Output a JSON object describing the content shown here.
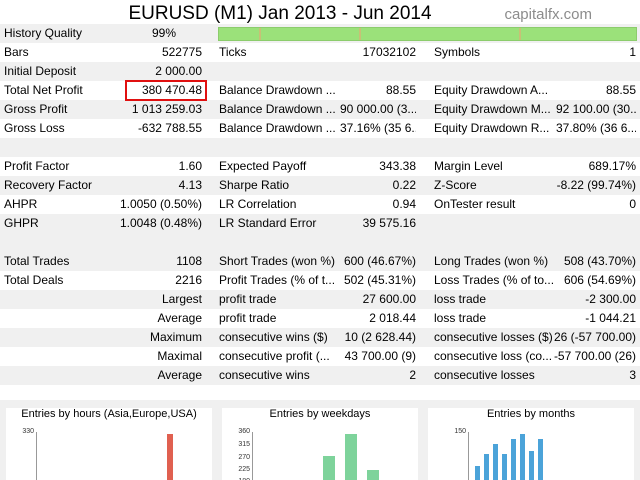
{
  "title": "EURUSD (M1)  Jan 2013 - Jun 2014",
  "brand": "capitalfx.com",
  "history_quality": {
    "label": "History Quality",
    "value": "99%"
  },
  "rows": {
    "bars": [
      "Bars",
      "522775",
      "Ticks",
      "17032102",
      "Symbols",
      "1"
    ],
    "initial_deposit": [
      "Initial Deposit",
      "2 000.00"
    ],
    "net_profit": [
      "Total Net Profit",
      "380 470.48",
      "Balance Drawdown ...",
      "88.55",
      "Equity Drawdown A...",
      "88.55"
    ],
    "gross_profit": [
      "Gross Profit",
      "1 013 259.03",
      "Balance Drawdown ...",
      "90 000.00 (3...",
      "Equity Drawdown M...",
      "92 100.00 (30..."
    ],
    "gross_loss": [
      "Gross Loss",
      "-632 788.55",
      "Balance Drawdown ...",
      "37.16% (35 6...",
      "Equity Drawdown R...",
      "37.80% (36 6..."
    ],
    "profit_factor": [
      "Profit Factor",
      "1.60",
      "Expected Payoff",
      "343.38",
      "Margin Level",
      "689.17%"
    ],
    "recovery_factor": [
      "Recovery Factor",
      "4.13",
      "Sharpe Ratio",
      "0.22",
      "Z-Score",
      "-8.22 (99.74%)"
    ],
    "ahpr": [
      "AHPR",
      "1.0050 (0.50%)",
      "LR Correlation",
      "0.94",
      "OnTester result",
      "0"
    ],
    "ghpr": [
      "GHPR",
      "1.0048 (0.48%)",
      "LR Standard Error",
      "39 575.16"
    ],
    "total_trades": [
      "Total Trades",
      "1108",
      "Short Trades (won %)",
      "600 (46.67%)",
      "Long Trades (won %)",
      "508 (43.70%)"
    ],
    "total_deals": [
      "Total Deals",
      "2216",
      "Profit Trades (% of t...",
      "502 (45.31%)",
      "Loss Trades (% of to...",
      "606 (54.69%)"
    ],
    "largest": [
      "Largest",
      "profit trade",
      "27 600.00",
      "loss trade",
      "-2 300.00"
    ],
    "average1": [
      "Average",
      "profit trade",
      "2 018.44",
      "loss trade",
      "-1 044.21"
    ],
    "maximum": [
      "Maximum",
      "consecutive wins ($)",
      "10 (2 628.44)",
      "consecutive losses ($)",
      "26 (-57 700.00)"
    ],
    "maximal": [
      "Maximal",
      "consecutive profit (...",
      "43 700.00 (9)",
      "consecutive loss (co...",
      "-57 700.00 (26)"
    ],
    "average2": [
      "Average",
      "consecutive wins",
      "2",
      "consecutive losses",
      "3"
    ]
  },
  "charts": [
    {
      "title": "Entries by hours (Asia,Europe,USA)",
      "ticks": [
        "330"
      ],
      "bar_color": "#e06050",
      "bars": [
        0.95
      ]
    },
    {
      "title": "Entries by weekdays",
      "ticks": [
        "360",
        "315",
        "270",
        "225",
        "180"
      ],
      "bar_color": "#7ed39b",
      "bars": [
        0.5,
        0.96,
        0.2
      ]
    },
    {
      "title": "Entries by months",
      "ticks": [
        "150"
      ],
      "bar_color": "#4ba3d9",
      "bars": [
        0.3,
        0.55,
        0.75,
        0.55,
        0.85,
        0.95,
        0.6,
        0.85
      ]
    }
  ]
}
